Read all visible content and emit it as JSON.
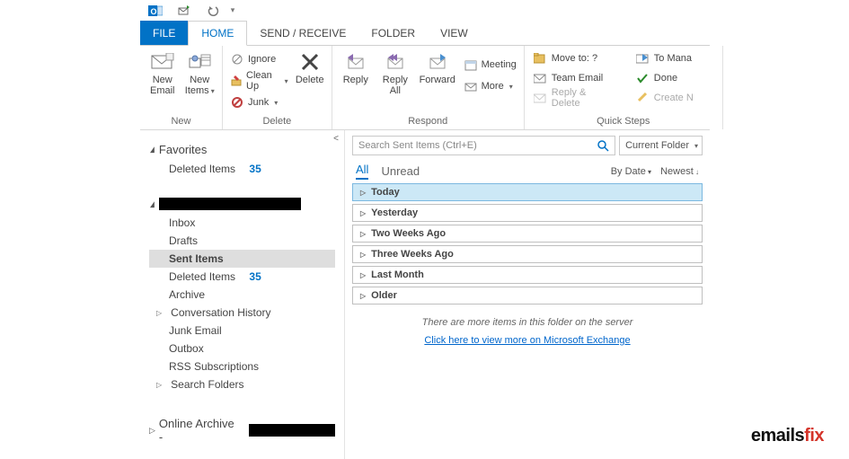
{
  "tabs": {
    "file": "FILE",
    "home": "HOME",
    "sendrec": "SEND / RECEIVE",
    "folder": "FOLDER",
    "view": "VIEW"
  },
  "ribbon": {
    "new": {
      "label": "New",
      "newEmail": "New\nEmail",
      "newItems": "New\nItems"
    },
    "delete": {
      "label": "Delete",
      "ignore": "Ignore",
      "cleanup": "Clean Up",
      "junk": "Junk",
      "delete": "Delete"
    },
    "respond": {
      "label": "Respond",
      "reply": "Reply",
      "replyAll": "Reply\nAll",
      "forward": "Forward",
      "meeting": "Meeting",
      "more": "More"
    },
    "quicksteps": {
      "label": "Quick Steps",
      "items": [
        {
          "icon": "move",
          "label": "Move to: ?"
        },
        {
          "icon": "mail",
          "label": "Team Email"
        },
        {
          "icon": "replydel",
          "label": "Reply & Delete"
        },
        {
          "icon": "tomgr",
          "label": "To Mana"
        },
        {
          "icon": "done",
          "label": "Done"
        },
        {
          "icon": "new",
          "label": "Create N"
        }
      ]
    }
  },
  "nav": {
    "favorites": "Favorites",
    "deletedItems": "Deleted Items",
    "deletedCount": "35",
    "folders": [
      "Inbox",
      "Drafts",
      "Sent Items",
      "Deleted Items",
      "Archive",
      "Conversation History",
      "Junk Email",
      "Outbox",
      "RSS Subscriptions",
      "Search Folders"
    ],
    "onlineArchive": "Online Archive -"
  },
  "list": {
    "searchPlaceholder": "Search Sent Items (Ctrl+E)",
    "scope": "Current Folder",
    "all": "All",
    "unread": "Unread",
    "sort1": "By Date",
    "sort2": "Newest",
    "groups": [
      "Today",
      "Yesterday",
      "Two Weeks Ago",
      "Three Weeks Ago",
      "Last Month",
      "Older"
    ],
    "moreMsg": "There are more items in this folder on the server",
    "moreLink": "Click here to view more on Microsoft Exchange"
  },
  "watermark": {
    "a": "emails",
    "b": "fix"
  }
}
